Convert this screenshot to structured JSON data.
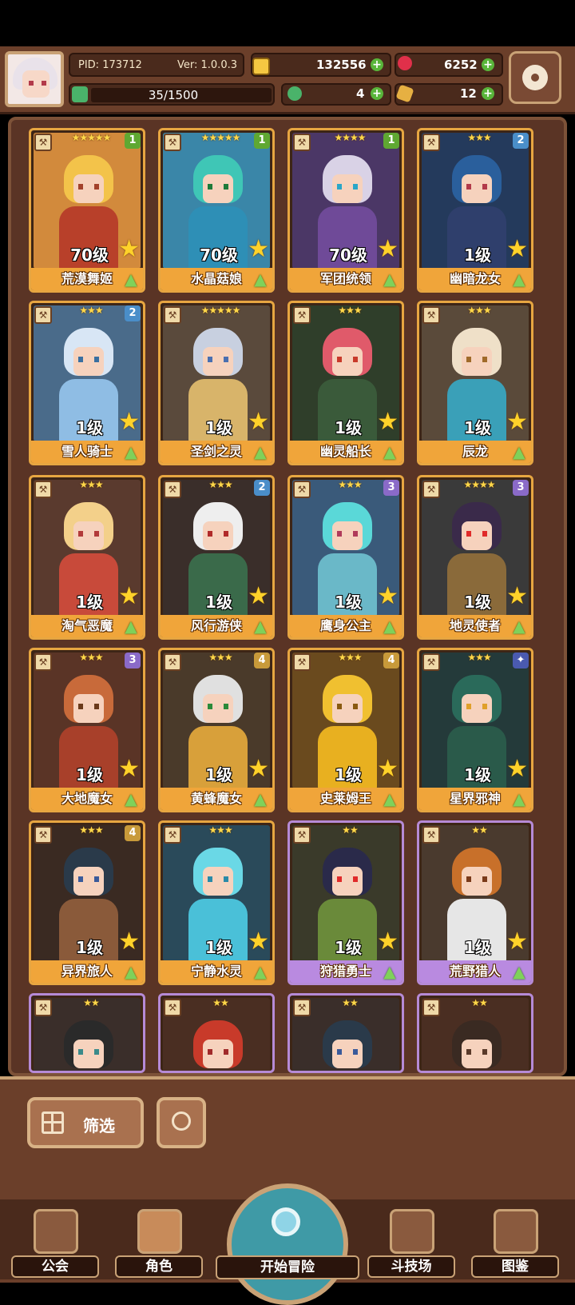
{
  "header": {
    "pid_text": "PID: 173712",
    "version_text": "Ver: 1.0.0.3",
    "level_progress": "35/1500",
    "gold": "132556",
    "gems": "6252",
    "clovers": "4",
    "tickets": "12"
  },
  "colors": {
    "card_gold": "#e7a641",
    "card_purple": "#b68ad6",
    "panel": "#5a3425",
    "accent_green": "#59b53a"
  },
  "cards": [
    {
      "level": "70级",
      "name": "荒漠舞姬",
      "stars": "★★★★★",
      "badge": "1",
      "badge_color": "#5fa832",
      "hair": "#f3c34a",
      "body": "#b8402a",
      "bg": "#d28a3c",
      "eye": "#a3422b",
      "border": "gold"
    },
    {
      "level": "70级",
      "name": "水晶菇娘",
      "stars": "★★★★★",
      "badge": "1",
      "badge_color": "#5fa832",
      "hair": "#3fc6b6",
      "body": "#2e8fb6",
      "bg": "#3a86a8",
      "eye": "#1d7b3a",
      "border": "gold"
    },
    {
      "level": "70级",
      "name": "军团统领",
      "stars": "★★★★",
      "badge": "1",
      "badge_color": "#5fa832",
      "hair": "#d9d2e6",
      "body": "#6f4a98",
      "bg": "#4b3766",
      "eye": "#2aa6c8",
      "border": "gold"
    },
    {
      "level": "1级",
      "name": "幽暗龙女",
      "stars": "★★★",
      "badge": "2",
      "badge_color": "#4a8ec9",
      "hair": "#2a5f9c",
      "body": "#2f3f6c",
      "bg": "#243a5c",
      "eye": "#b23a4a",
      "border": "gold"
    },
    {
      "level": "1级",
      "name": "雪人骑士",
      "stars": "★★★",
      "badge": "2",
      "badge_color": "#4a8ec9",
      "hair": "#d8e6f5",
      "body": "#8fbde4",
      "bg": "#4a6b8a",
      "eye": "#3a6fa0",
      "border": "gold"
    },
    {
      "level": "1级",
      "name": "圣剑之灵",
      "stars": "★★★★★",
      "badge": "",
      "badge_color": "",
      "hair": "#c8d0e0",
      "body": "#d8b46a",
      "bg": "#5a4a3c",
      "eye": "#4a6fb0",
      "border": "gold"
    },
    {
      "level": "1级",
      "name": "幽灵船长",
      "stars": "★★★",
      "badge": "",
      "badge_color": "",
      "hair": "#e05a6a",
      "body": "#3a5a3a",
      "bg": "#2f3e2a",
      "eye": "#c83a2a",
      "border": "gold"
    },
    {
      "level": "1级",
      "name": "辰龙",
      "stars": "★★★",
      "badge": "",
      "badge_color": "",
      "hair": "#efe0c8",
      "body": "#3aa0b8",
      "bg": "#5a4a3a",
      "eye": "#a06a2a",
      "border": "gold"
    },
    {
      "level": "1级",
      "name": "淘气恶魔",
      "stars": "★★★",
      "badge": "",
      "badge_color": "",
      "hair": "#f3d08a",
      "body": "#c84a3a",
      "bg": "#5a3a2e",
      "eye": "#b23a3a",
      "border": "gold"
    },
    {
      "level": "1级",
      "name": "风行游侠",
      "stars": "★★★",
      "badge": "2",
      "badge_color": "#4a8ec9",
      "hair": "#eeeeee",
      "body": "#3a6a4a",
      "bg": "#3a2e2a",
      "eye": "#b02a2a",
      "border": "gold"
    },
    {
      "level": "1级",
      "name": "鹰身公主",
      "stars": "★★★",
      "badge": "3",
      "badge_color": "#8a6ac8",
      "hair": "#5ad8d8",
      "body": "#6ab8c8",
      "bg": "#3a5a7a",
      "eye": "#b03a5a",
      "border": "gold"
    },
    {
      "level": "1级",
      "name": "地灵使者",
      "stars": "★★★★",
      "badge": "3",
      "badge_color": "#8a6ac8",
      "hair": "#3a2a4a",
      "body": "#8a6a3a",
      "bg": "#3a3a3a",
      "eye": "#e02a2a",
      "border": "gold"
    },
    {
      "level": "1级",
      "name": "大地魔女",
      "stars": "★★★",
      "badge": "3",
      "badge_color": "#8a6ac8",
      "hair": "#c86a3a",
      "body": "#a8402a",
      "bg": "#5a3426",
      "eye": "#6a3a1a",
      "border": "gold"
    },
    {
      "level": "1级",
      "name": "黄蜂魔女",
      "stars": "★★★",
      "badge": "4",
      "badge_color": "#c89a3a",
      "hair": "#e0e0e0",
      "body": "#d8a03a",
      "bg": "#4a3a2a",
      "eye": "#2a8a3a",
      "border": "gold"
    },
    {
      "level": "1级",
      "name": "史莱姆王",
      "stars": "★★★",
      "badge": "4",
      "badge_color": "#c89a3a",
      "hair": "#f0c030",
      "body": "#e8b020",
      "bg": "#6a4a1e",
      "eye": "#8a5a10",
      "border": "gold"
    },
    {
      "level": "1级",
      "name": "星界邪神",
      "stars": "★★★",
      "badge": "✦",
      "badge_color": "#4a5ab0",
      "hair": "#2a6a5a",
      "body": "#2a5a4a",
      "bg": "#243a3a",
      "eye": "#e0a02a",
      "border": "gold"
    },
    {
      "level": "1级",
      "name": "异界旅人",
      "stars": "★★★",
      "badge": "4",
      "badge_color": "#c89a3a",
      "hair": "#2a3a4a",
      "body": "#8a5a3a",
      "bg": "#3a2a22",
      "eye": "#3a5a9a",
      "border": "gold"
    },
    {
      "level": "1级",
      "name": "宁静水灵",
      "stars": "★★★",
      "badge": "",
      "badge_color": "",
      "hair": "#6ad8e6",
      "body": "#4ac0d8",
      "bg": "#2a4a5a",
      "eye": "#2a8aa8",
      "border": "gold"
    },
    {
      "level": "1级",
      "name": "狩猎勇士",
      "stars": "★★",
      "badge": "",
      "badge_color": "",
      "hair": "#2a2a4a",
      "body": "#6a8a3a",
      "bg": "#3a3a2a",
      "eye": "#e02a2a",
      "border": "purple"
    },
    {
      "level": "1级",
      "name": "荒野猎人",
      "stars": "★★",
      "badge": "",
      "badge_color": "",
      "hair": "#c8702a",
      "body": "#e6e6e6",
      "bg": "#4a3a2e",
      "eye": "#7a3a1a",
      "border": "purple"
    },
    {
      "level": "",
      "name": "",
      "stars": "★★",
      "badge": "",
      "badge_color": "",
      "hair": "#2a2a2a",
      "body": "#e6d6c6",
      "bg": "#3a2e2a",
      "eye": "#3a8a8a",
      "border": "purple"
    },
    {
      "level": "",
      "name": "",
      "stars": "★★",
      "badge": "",
      "badge_color": "",
      "hair": "#c83a2a",
      "body": "#a8402a",
      "bg": "#4a2e22",
      "eye": "#a02a2a",
      "border": "purple"
    },
    {
      "level": "",
      "name": "",
      "stars": "★★",
      "badge": "",
      "badge_color": "",
      "hair": "#2a3a4a",
      "body": "#3a4a5a",
      "bg": "#3a2e2a",
      "eye": "#3a5a9a",
      "border": "purple"
    },
    {
      "level": "",
      "name": "",
      "stars": "★★",
      "badge": "",
      "badge_color": "",
      "hair": "#3a2a22",
      "body": "#c86a2a",
      "bg": "#4a2e22",
      "eye": "#5a3a2a",
      "border": "purple"
    }
  ],
  "controls": {
    "filter_label": "筛选"
  },
  "nav": {
    "items": [
      {
        "label": "公会",
        "icon": "guild-hall-icon"
      },
      {
        "label": "角色",
        "icon": "character-icon"
      },
      {
        "label": "开始冒险",
        "icon": "adventure-map-icon"
      },
      {
        "label": "斗技场",
        "icon": "arena-swords-icon"
      },
      {
        "label": "图鉴",
        "icon": "codex-book-icon"
      }
    ]
  }
}
